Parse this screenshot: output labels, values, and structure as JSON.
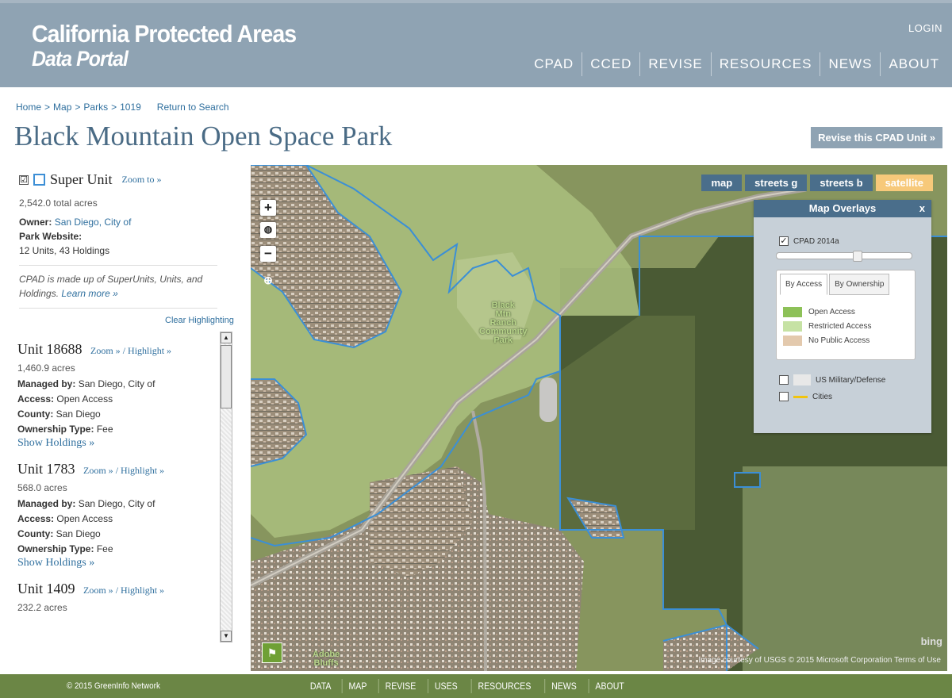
{
  "header": {
    "logo_line1": "California Protected Areas",
    "logo_line2": "Data Portal",
    "login": "LOGIN",
    "nav": [
      "CPAD",
      "CCED",
      "REVISE",
      "RESOURCES",
      "NEWS",
      "ABOUT"
    ]
  },
  "breadcrumb": {
    "items": [
      "Home",
      "Map",
      "Parks",
      "1019"
    ],
    "separator": ">",
    "return_link": "Return to Search"
  },
  "page": {
    "title": "Black Mountain Open Space Park",
    "revise_button": "Revise this CPAD Unit »"
  },
  "super_unit": {
    "checkbox": "☑",
    "title": "Super Unit",
    "zoom_link": "Zoom to »",
    "acres": "2,542.0 total acres",
    "owner_label": "Owner:",
    "owner_value": "San Diego, City of",
    "website_label": "Park Website:",
    "summary": "12 Units, 43 Holdings",
    "note": "CPAD is made up of SuperUnits, Units, and Holdings.",
    "learn_more": "Learn more »",
    "clear_highlighting": "Clear Highlighting"
  },
  "units": [
    {
      "title": "Unit 18688",
      "zoom": "Zoom »",
      "highlight": "Highlight »",
      "acres": "1,460.9 acres",
      "managed_label": "Managed by:",
      "managed_value": "San Diego, City of",
      "access_label": "Access:",
      "access_value": "Open Access",
      "county_label": "County:",
      "county_value": "San Diego",
      "ownership_label": "Ownership Type:",
      "ownership_value": "Fee",
      "show_holdings": "Show Holdings »"
    },
    {
      "title": "Unit 1783",
      "zoom": "Zoom »",
      "highlight": "Highlight »",
      "acres": "568.0 acres",
      "managed_label": "Managed by:",
      "managed_value": "San Diego, City of",
      "access_label": "Access:",
      "access_value": "Open Access",
      "county_label": "County:",
      "county_value": "San Diego",
      "ownership_label": "Ownership Type:",
      "ownership_value": "Fee",
      "show_holdings": "Show Holdings »"
    },
    {
      "title": "Unit 1409",
      "zoom": "Zoom »",
      "highlight": "Highlight »",
      "acres": "232.2 acres"
    }
  ],
  "map": {
    "basemaps": [
      "map",
      "streets g",
      "streets b",
      "satellite"
    ],
    "active_basemap": "satellite",
    "zoom_in": "+",
    "zoom_out": "−",
    "labels": {
      "park": "Black\nMtn\nRanch\nCommunity\nPark",
      "adobe": "Adobe\nBluffs"
    },
    "bing": "bing",
    "attribution": "Image courtesy of USGS © 2015 Microsoft Corporation",
    "terms": "Terms of Use"
  },
  "overlays": {
    "title": "Map Overlays",
    "close": "x",
    "cpad_label": "CPAD 2014a",
    "cpad_checked": true,
    "opacity": 0.6,
    "tabs": [
      "By Access",
      "By Ownership"
    ],
    "active_tab": "By Access",
    "legend": [
      {
        "label": "Open Access",
        "color": "#8dc158"
      },
      {
        "label": "Restricted Access",
        "color": "#c6e2a4"
      },
      {
        "label": "No Public Access",
        "color": "#e3c9ad"
      }
    ],
    "military_label": "US Military/Defense",
    "cities_label": "Cities"
  },
  "footer": {
    "copyright": "© 2015 GreenInfo Network",
    "nav": [
      "DATA",
      "MAP",
      "REVISE",
      "USES",
      "RESOURCES",
      "NEWS",
      "ABOUT"
    ]
  },
  "colors": {
    "header_bg": "#8fa3b3",
    "footer_bg": "#6b8645",
    "link": "#2f6f9e",
    "basemap_active": "#f7c97a",
    "overlay_header": "#4a6e8b",
    "boundary": "#3b8fd6"
  }
}
